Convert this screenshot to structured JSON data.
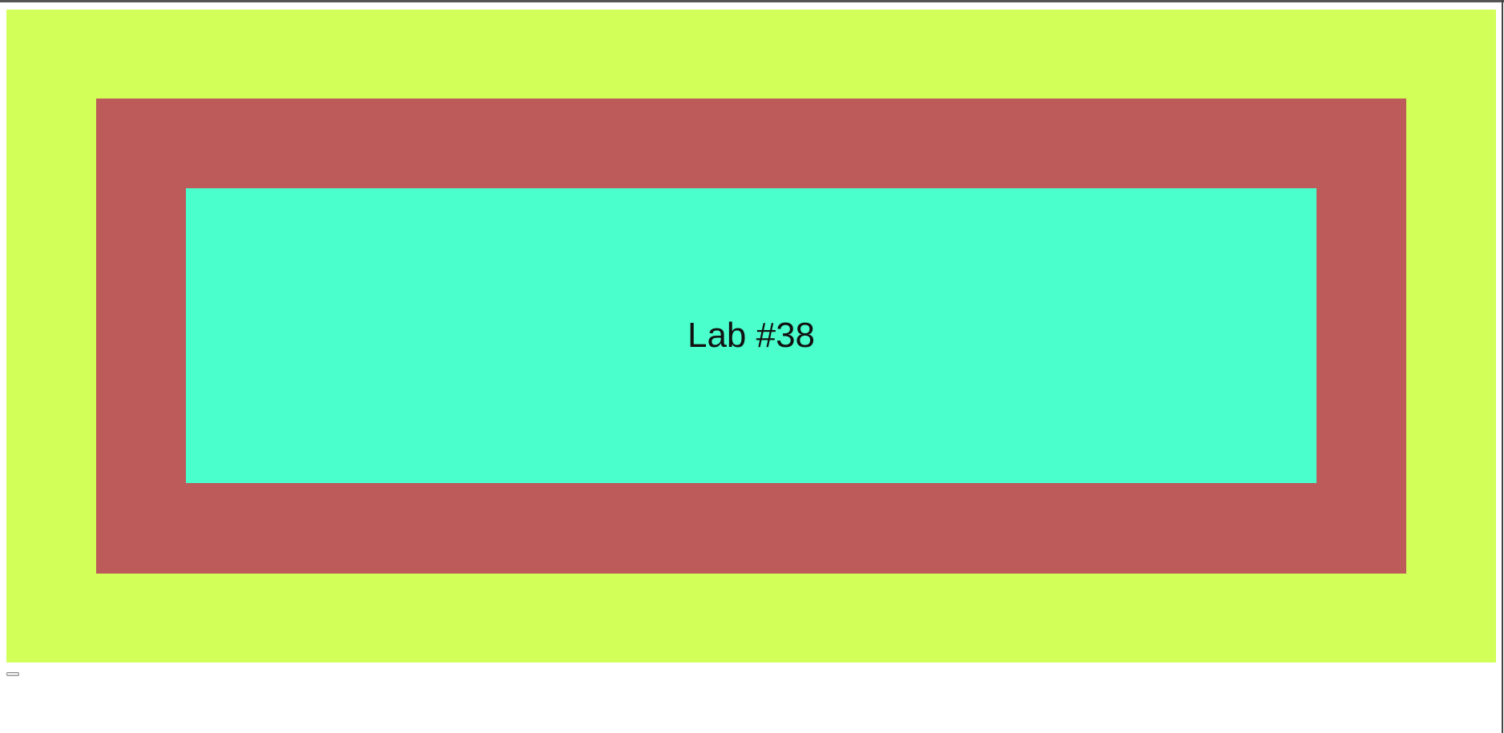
{
  "panel": {
    "title": "Lab #38"
  },
  "colors": {
    "outer": "#d2ff58",
    "middle": "#bd5a5a",
    "inner": "#4affcc",
    "text": "#111111"
  },
  "controls": {
    "tiny_button_label": ""
  }
}
